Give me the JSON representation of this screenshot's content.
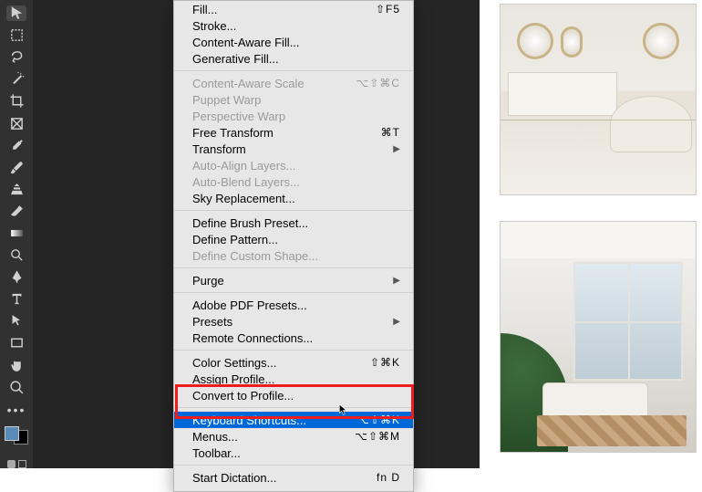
{
  "toolbar": {
    "tools": [
      {
        "name": "move-tool"
      },
      {
        "name": "marquee-tool"
      },
      {
        "name": "lasso-tool"
      },
      {
        "name": "magic-wand-tool"
      },
      {
        "name": "crop-tool"
      },
      {
        "name": "frame-tool"
      },
      {
        "name": "eyedropper-tool"
      },
      {
        "name": "brush-tool"
      },
      {
        "name": "clone-stamp-tool"
      },
      {
        "name": "eraser-tool"
      },
      {
        "name": "gradient-tool"
      },
      {
        "name": "dodge-tool"
      },
      {
        "name": "pen-tool"
      },
      {
        "name": "type-tool"
      },
      {
        "name": "path-select-tool"
      },
      {
        "name": "rectangle-tool"
      },
      {
        "name": "hand-tool"
      },
      {
        "name": "zoom-tool"
      }
    ]
  },
  "menu": {
    "groups": [
      [
        {
          "label": "Fill...",
          "shortcut": "⇧F5",
          "enabled": true
        },
        {
          "label": "Stroke...",
          "enabled": true
        },
        {
          "label": "Content-Aware Fill...",
          "enabled": true
        },
        {
          "label": "Generative Fill...",
          "enabled": true
        }
      ],
      [
        {
          "label": "Content-Aware Scale",
          "shortcut": "⌥⇧⌘C",
          "enabled": false
        },
        {
          "label": "Puppet Warp",
          "enabled": false
        },
        {
          "label": "Perspective Warp",
          "enabled": false
        },
        {
          "label": "Free Transform",
          "shortcut": "⌘T",
          "enabled": true
        },
        {
          "label": "Transform",
          "submenu": true,
          "enabled": true
        },
        {
          "label": "Auto-Align Layers...",
          "enabled": false
        },
        {
          "label": "Auto-Blend Layers...",
          "enabled": false
        },
        {
          "label": "Sky Replacement...",
          "enabled": true
        }
      ],
      [
        {
          "label": "Define Brush Preset...",
          "enabled": true
        },
        {
          "label": "Define Pattern...",
          "enabled": true
        },
        {
          "label": "Define Custom Shape...",
          "enabled": false
        }
      ],
      [
        {
          "label": "Purge",
          "submenu": true,
          "enabled": true
        }
      ],
      [
        {
          "label": "Adobe PDF Presets...",
          "enabled": true
        },
        {
          "label": "Presets",
          "submenu": true,
          "enabled": true
        },
        {
          "label": "Remote Connections...",
          "enabled": true
        }
      ],
      [
        {
          "label": "Color Settings...",
          "shortcut": "⇧⌘K",
          "enabled": true
        },
        {
          "label": "Assign Profile...",
          "enabled": true
        },
        {
          "label": "Convert to Profile...",
          "enabled": true
        }
      ],
      [
        {
          "label": "Keyboard Shortcuts...",
          "shortcut": "⌥⇧⌘K",
          "enabled": true,
          "selected": true
        },
        {
          "label": "Menus...",
          "shortcut": "⌥⇧⌘M",
          "enabled": true
        },
        {
          "label": "Toolbar...",
          "enabled": true
        }
      ],
      [
        {
          "label": "Start Dictation...",
          "shortcut": "fn D",
          "enabled": true
        }
      ]
    ]
  }
}
